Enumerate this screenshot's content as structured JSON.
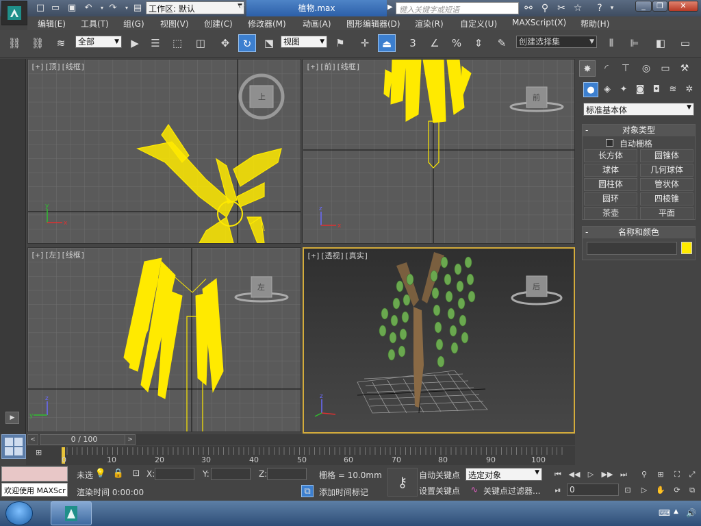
{
  "app": {
    "workspace_label": "工作区: 默认",
    "document_title": "植物.max",
    "search_placeholder": "键入关键字或短语"
  },
  "menu": [
    "编辑(E)",
    "工具(T)",
    "组(G)",
    "视图(V)",
    "创建(C)",
    "修改器(M)",
    "动画(A)",
    "图形编辑器(D)",
    "渲染(R)",
    "自定义(U)",
    "MAXScript(X)",
    "帮助(H)"
  ],
  "toolbar": {
    "selection_filter": "全部",
    "ref_coord": "视图",
    "snap_label": "3",
    "percent_label": "%",
    "named_selection": "创建选择集"
  },
  "viewports": {
    "top": {
      "label": "[+][顶][线框]",
      "viewcube": "上"
    },
    "front": {
      "label": "[+][前][线框]",
      "viewcube": "前"
    },
    "left": {
      "label": "[+][左][线框]",
      "viewcube": "左"
    },
    "perspective": {
      "label": "[+][透视][真实]",
      "viewcube": "后"
    }
  },
  "command_panel": {
    "category": "标准基本体",
    "object_type_title": "对象类型",
    "auto_grid_label": "自动栅格",
    "object_buttons": [
      "长方体",
      "圆锥体",
      "球体",
      "几何球体",
      "圆柱体",
      "管状体",
      "圆环",
      "四棱锥",
      "茶壶",
      "平面"
    ],
    "name_color_title": "名称和颜色",
    "object_color": "#ffea00"
  },
  "timeline": {
    "frame_display": "0 / 100",
    "ticks": [
      "0",
      "10",
      "20",
      "30",
      "40",
      "50",
      "60",
      "70",
      "80",
      "90",
      "100"
    ]
  },
  "status": {
    "welcome": "欢迎使用 MAXScr",
    "unselected": "未选",
    "x_label": "X:",
    "y_label": "Y:",
    "z_label": "Z:",
    "grid": "栅格 = 10.0mm",
    "auto_key": "自动关键点",
    "set_key": "设置关键点",
    "selected_object": "选定对象",
    "key_filters": "关键点过滤器...",
    "render_time": "渲染时间  0:00:00",
    "add_time_tag": "添加时间标记",
    "current_frame": "0"
  }
}
